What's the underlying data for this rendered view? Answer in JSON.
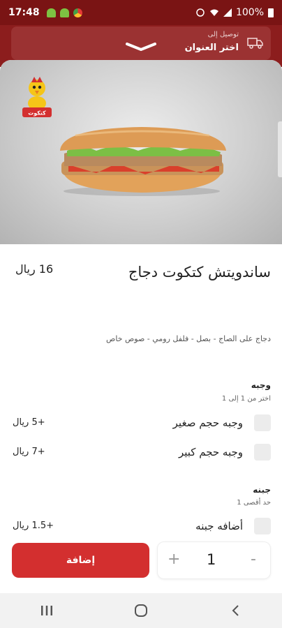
{
  "status_bar": {
    "time": "17:48",
    "battery": "100%"
  },
  "header": {
    "delivery_to": "توصيل إلى",
    "choose_address": "اختر العنوان"
  },
  "product": {
    "title": "ساندويتش كتكوت دجاج",
    "price": "16 ريال",
    "description": "دجاج على الصاج - بصل - فلفل رومي - صوص خاص",
    "brand_logo_text": "كتكوت"
  },
  "option_groups": [
    {
      "title": "وجبه",
      "subtitle": "اختر من 1 إلى 1",
      "options": [
        {
          "label": "وجبه حجم صغير",
          "price": "+5 ريال"
        },
        {
          "label": "وجبه حجم كبير",
          "price": "+7 ريال"
        }
      ]
    },
    {
      "title": "جبنه",
      "subtitle": "حد أقصى 1",
      "options": [
        {
          "label": "أضافه جبنه",
          "price": "+1.5 ريال"
        }
      ]
    }
  ],
  "actions": {
    "add_label": "إضافة",
    "quantity": "1",
    "plus": "+",
    "minus": "-"
  },
  "colors": {
    "primary": "#d32f2f",
    "header": "#8c1d1d",
    "status_bar": "#7a1414"
  }
}
